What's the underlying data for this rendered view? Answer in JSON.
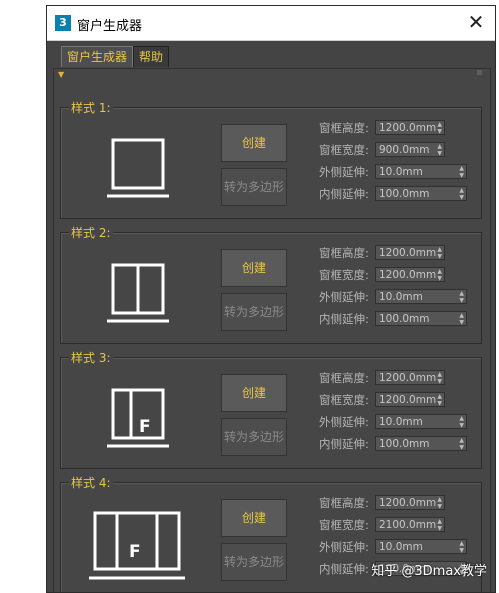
{
  "window": {
    "title": "窗户生成器",
    "app_icon_text": "3",
    "close_label": "✕"
  },
  "tabs": [
    {
      "label": "窗户生成器"
    },
    {
      "label": "帮助"
    }
  ],
  "groups": [
    {
      "label": "样式 1:",
      "create_label": "创建",
      "convert_label": "转为多边形",
      "params": [
        {
          "label": "窗框高度:",
          "value": "1200.0mm"
        },
        {
          "label": "窗框宽度:",
          "value": "900.0mm"
        },
        {
          "label": "外侧延伸:",
          "value": "10.0mm"
        },
        {
          "label": "内侧延伸:",
          "value": "100.0mm"
        }
      ]
    },
    {
      "label": "样式 2:",
      "create_label": "创建",
      "convert_label": "转为多边形",
      "params": [
        {
          "label": "窗框高度:",
          "value": "1200.0mm"
        },
        {
          "label": "窗框宽度:",
          "value": "1200.0mm"
        },
        {
          "label": "外侧延伸:",
          "value": "10.0mm"
        },
        {
          "label": "内侧延伸:",
          "value": "100.0mm"
        }
      ]
    },
    {
      "label": "样式 3:",
      "create_label": "创建",
      "convert_label": "转为多边形",
      "icon_letter": "F",
      "params": [
        {
          "label": "窗框高度:",
          "value": "1200.0mm"
        },
        {
          "label": "窗框宽度:",
          "value": "1200.0mm"
        },
        {
          "label": "外侧延伸:",
          "value": "10.0mm"
        },
        {
          "label": "内侧延伸:",
          "value": "100.0mm"
        }
      ]
    },
    {
      "label": "样式 4:",
      "create_label": "创建",
      "convert_label": "转为多边形",
      "icon_letter": "F",
      "params": [
        {
          "label": "窗框高度:",
          "value": "1200.0mm"
        },
        {
          "label": "窗框宽度:",
          "value": "2100.0mm"
        },
        {
          "label": "外侧延伸:",
          "value": "10.0mm"
        },
        {
          "label": "内侧延伸:",
          "value": "100.0mm"
        }
      ]
    }
  ],
  "watermark": "知乎 @3Dmax教学",
  "colors": {
    "accent": "#e7c744",
    "panel": "#464646",
    "text": "#b5b5b5"
  }
}
